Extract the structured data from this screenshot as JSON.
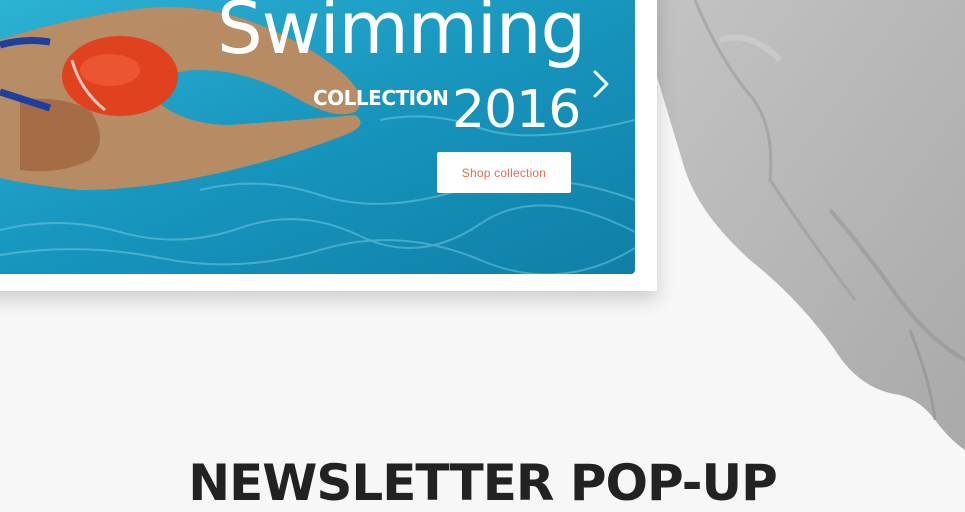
{
  "banner": {
    "title": "Swimming",
    "subtitle": "COLLECTION",
    "year": "2016",
    "cta_label": "Shop collection",
    "next_icon": "chevron-right-icon"
  },
  "section": {
    "headline": "NEWSLETTER POP-UP"
  },
  "colors": {
    "background": "#f7f7f7",
    "water": "#1a9bc4",
    "cap": "#e0421f",
    "cta_text": "#e26e4f",
    "headline": "#222222",
    "hoodie": "#b9b9b9"
  }
}
